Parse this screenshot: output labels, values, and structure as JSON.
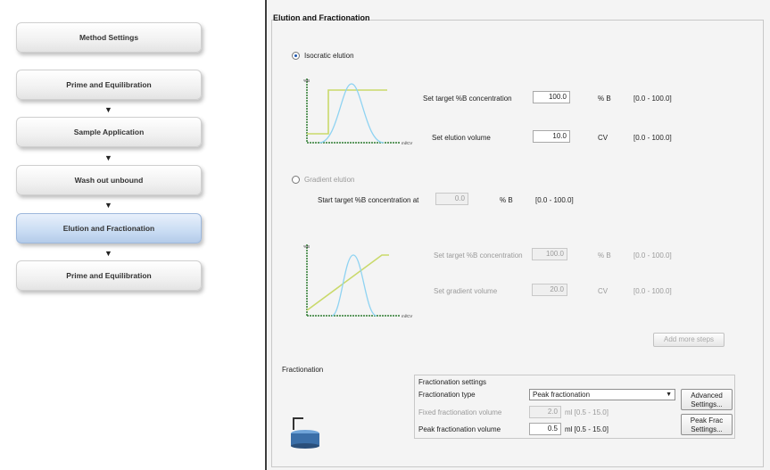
{
  "steps": [
    {
      "label": "Method Settings"
    },
    {
      "label": "Prime and Equilibration"
    },
    {
      "label": "Sample Application"
    },
    {
      "label": "Wash out unbound"
    },
    {
      "label": "Elution and Fractionation"
    },
    {
      "label": "Prime and Equilibration"
    }
  ],
  "panel": {
    "title": "Elution and Fractionation",
    "isocratic": {
      "label": "Isocratic elution",
      "target_label": "Set target %B concentration",
      "target_value": "100.0",
      "target_unit": "% B",
      "target_range": "[0.0 - 100.0]",
      "volume_label": "Set elution volume",
      "volume_value": "10.0",
      "volume_unit": "CV",
      "volume_range": "[0.0 - 100.0]"
    },
    "gradient": {
      "label": "Gradient elution",
      "start_label": "Start target %B concentration at",
      "start_value": "0.0",
      "start_unit": "% B",
      "start_range": "[0.0 - 100.0]",
      "target_label": "Set target %B concentration",
      "target_value": "100.0",
      "target_unit": "% B",
      "target_range": "[0.0 - 100.0]",
      "volume_label": "Set gradient volume",
      "volume_value": "20.0",
      "volume_unit": "CV",
      "volume_range": "[0.0 - 100.0]",
      "add_steps": "Add more steps"
    },
    "chart_axis": {
      "y_label": "%B",
      "x_label": "ml/CV"
    },
    "fractionation": {
      "section_label": "Fractionation",
      "settings_label": "Fractionation settings",
      "type_label": "Fractionation type",
      "type_value": "Peak fractionation",
      "fixed_label": "Fixed fractionation volume",
      "fixed_value": "2.0",
      "fixed_range": "ml [0.5 - 15.0]",
      "peak_label": "Peak fractionation volume",
      "peak_value": "0.5",
      "peak_range": "ml [0.5 - 15.0]",
      "advanced_btn": "Advanced Settings...",
      "peakfrac_btn": "Peak Frac Settings..."
    }
  },
  "colors": {
    "active_step": "#c9dcf3",
    "peak_curve": "#8fd3f2",
    "concentration_line": "#c9d96a",
    "baseline": "#2e7d32"
  }
}
